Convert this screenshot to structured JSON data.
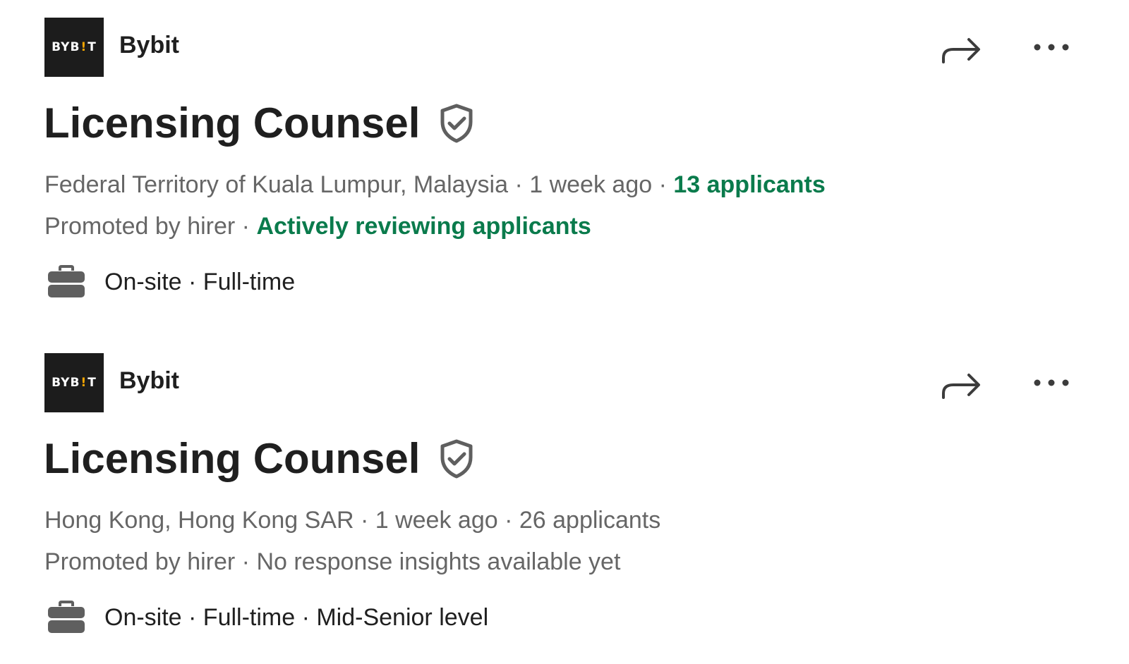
{
  "jobs": [
    {
      "company": "Bybit",
      "logo": {
        "left": "BYB",
        "mark": "!",
        "right": "T"
      },
      "title": "Licensing Counsel",
      "location": "Federal Territory of Kuala Lumpur, Malaysia",
      "posted": "1 week ago",
      "applicants": "13 applicants",
      "promoted": "Promoted by hirer",
      "status": "Actively reviewing applicants",
      "job_type": "On-site · Full-time"
    },
    {
      "company": "Bybit",
      "logo": {
        "left": "BYB",
        "mark": "!",
        "right": "T"
      },
      "title": "Licensing Counsel",
      "location": "Hong Kong, Hong Kong SAR",
      "posted": "1 week ago",
      "applicants": "26 applicants",
      "promoted": "Promoted by hirer",
      "status": "No response insights available yet",
      "job_type": "On-site · Full-time · Mid-Senior level"
    }
  ],
  "separator": " · ",
  "icons": {
    "share": "share-arrow-icon",
    "more": "more-horizontal-icon",
    "verified": "shield-check-icon",
    "job_type": "briefcase-icon"
  },
  "colors": {
    "accent_green": "#0a7b4c",
    "logo_bg": "#1c1c1c",
    "logo_mark": "#f7a600",
    "muted_text": "#666666",
    "icon_gray": "#5f5f5f"
  }
}
